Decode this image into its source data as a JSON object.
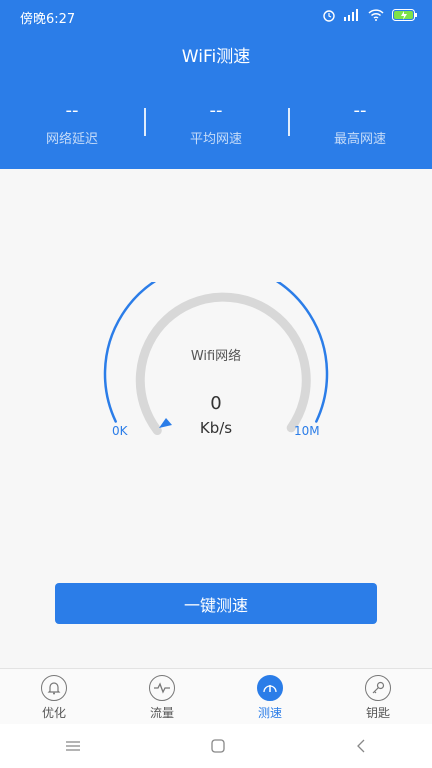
{
  "status": {
    "time": "傍晚6:27"
  },
  "header": {
    "title": "WiFi测速"
  },
  "metrics": [
    {
      "value": "--",
      "label": "网络延迟"
    },
    {
      "value": "--",
      "label": "平均网速"
    },
    {
      "value": "--",
      "label": "最高网速"
    }
  ],
  "gauge": {
    "network": "Wifi网络",
    "speed": "0",
    "unit": "Kb/s",
    "min_label": "0K",
    "max_label": "10M",
    "level": 0
  },
  "action": {
    "button_label": "一键测速"
  },
  "tabs": [
    {
      "label": "优化",
      "icon": "bell-icon",
      "active": false
    },
    {
      "label": "流量",
      "icon": "pulse-icon",
      "active": false
    },
    {
      "label": "测速",
      "icon": "speedometer-icon",
      "active": true
    },
    {
      "label": "钥匙",
      "icon": "key-icon",
      "active": false
    }
  ],
  "colors": {
    "primary": "#2b7de8",
    "gauge_track": "#d8d8d8"
  }
}
